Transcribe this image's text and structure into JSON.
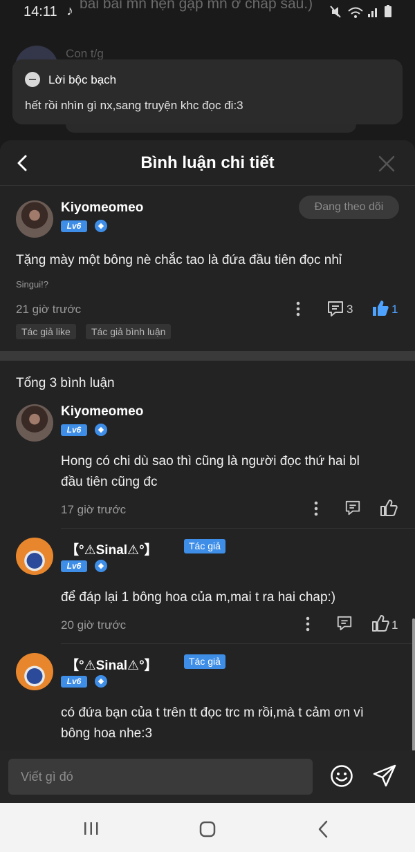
{
  "status_bar": {
    "time": "14:11",
    "app_icon": "tiktok-icon",
    "behind_text": "bai bai mn hẹn gặp mn ở chap sau.)",
    "icons": [
      "mute-icon",
      "wifi-icon",
      "signal-icon",
      "battery-icon"
    ]
  },
  "background_page": {
    "name": "Con t/g"
  },
  "popup": {
    "title": "Lời bộc bạch",
    "text": "hết rồi nhìn gì nx,sang truyện khc đọc đi:3"
  },
  "sheet": {
    "title": "Bình luận chi tiết",
    "back_icon": "chevron-left-icon",
    "close_icon": "close-icon"
  },
  "main_comment": {
    "username": "Kiyomeomeo",
    "level": "Lv6",
    "follow_label": "Đang theo dõi",
    "text": "Tặng mày một bông nè chắc tao là đứa đầu tiên đọc nhỉ",
    "note": "Singui!?",
    "time": "21 giờ trước",
    "reply_count": "3",
    "like_count": "1",
    "tags": [
      "Tác giả like",
      "Tác giả bình luận"
    ]
  },
  "total_label": "Tổng 3 bình luận",
  "replies": [
    {
      "username": "Kiyomeomeo",
      "level": "Lv6",
      "author_tag": "",
      "text_lines": [
        "Hong có chi dù sao thì cũng là người đọc thứ hai bl",
        "đầu tiên cũng đc"
      ],
      "time": "17 giờ trước",
      "like_count": ""
    },
    {
      "username": "【°⚠Sinal⚠°】",
      "level": "Lv6",
      "author_tag": "Tác giả",
      "text_lines": [
        "để đáp lại 1 bông hoa của m,mai t ra hai chap:)",
        ""
      ],
      "time": "20 giờ trước",
      "like_count": "1"
    },
    {
      "username": "【°⚠Sinal⚠°】",
      "level": "Lv6",
      "author_tag": "Tác giả",
      "text_lines": [
        "có đứa bạn của t trên tt đọc trc m rồi,mà t cảm ơn vì",
        "bông hoa nhe:3"
      ],
      "time": "",
      "like_count": ""
    }
  ],
  "input": {
    "placeholder": "Viết gì đó"
  },
  "colors": {
    "accent": "#3e8ee8",
    "like_blue": "#4da3ff",
    "sheet_bg": "#232323"
  }
}
